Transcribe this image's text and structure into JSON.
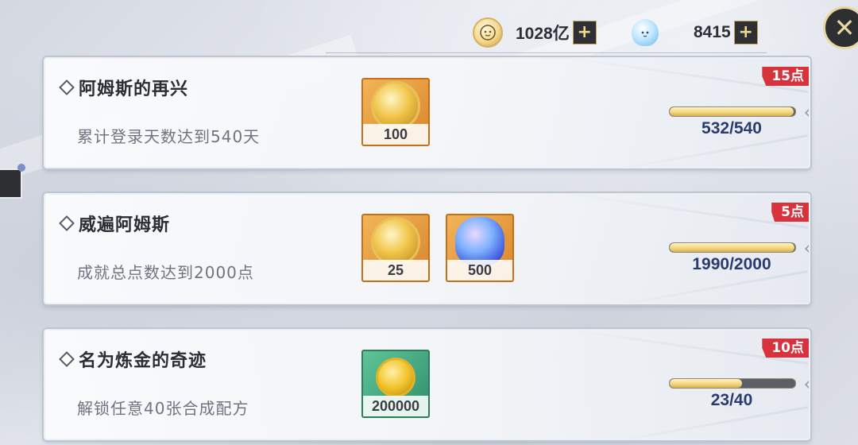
{
  "topbar": {
    "gold": {
      "icon": "gold-face-icon",
      "value": "1028亿",
      "add_label": "+"
    },
    "gem": {
      "icon": "slime-gem-icon",
      "value": "8415",
      "add_label": "+"
    },
    "close_label": "✕"
  },
  "achievements": [
    {
      "title": "阿姆斯的再兴",
      "description": "累计登录天数达到540天",
      "points": "15点",
      "progress_text": "532/540",
      "progress": 0.985,
      "rewards": [
        {
          "icon": "gold-medal-icon",
          "count": "100"
        }
      ]
    },
    {
      "title": "威遍阿姆斯",
      "description": "成就总点数达到2000点",
      "points": "5点",
      "progress_text": "1990/2000",
      "progress": 0.995,
      "rewards": [
        {
          "icon": "gold-medal-icon",
          "count": "25"
        },
        {
          "icon": "blue-slime-icon",
          "count": "500"
        }
      ]
    },
    {
      "title": "名为炼金的奇迹",
      "description": "解锁任意40张合成配方",
      "points": "10点",
      "progress_text": "23/40",
      "progress": 0.575,
      "rewards": [
        {
          "icon": "gold-coin-icon",
          "count": "200000"
        }
      ]
    }
  ],
  "colors": {
    "points_badge": "#d8323c",
    "progress_text": "#2a3b6e",
    "bar_fill": "#f1d47b"
  }
}
